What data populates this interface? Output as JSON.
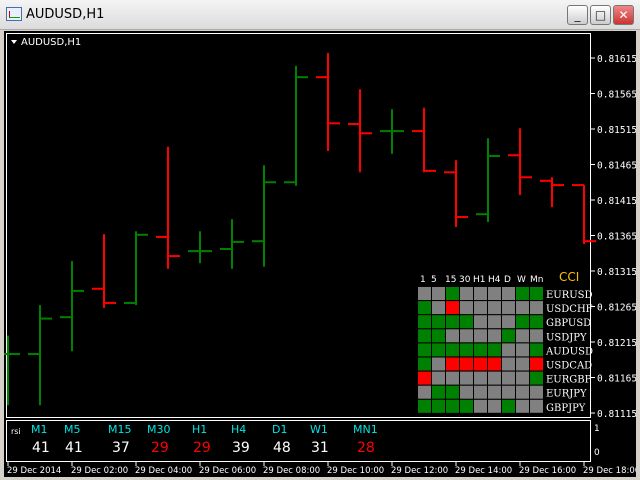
{
  "window": {
    "title": "AUDUSD,H1",
    "minimize": "_",
    "maximize": "□",
    "close": "✕"
  },
  "chart": {
    "label": "AUDUSD,H1",
    "colors": {
      "up": "#008000",
      "down": "#ff0000",
      "bg": "#000000",
      "text": "#ffffff",
      "cci": "#ffc000",
      "cyan": "#00e5e5",
      "gray": "#808080"
    },
    "price_range": [
      0.81115,
      0.81615
    ],
    "price_labels": [
      "0.81615",
      "0.81565",
      "0.81515",
      "0.81465",
      "0.81415",
      "0.81365",
      "0.81315",
      "0.81265",
      "0.81215",
      "0.81165",
      "0.81115"
    ],
    "bars": [
      {
        "o": 0.81198,
        "h": 0.81224,
        "l": 0.81126,
        "c": 0.81198
      },
      {
        "o": 0.81198,
        "h": 0.81267,
        "l": 0.81126,
        "c": 0.81248
      },
      {
        "o": 0.8125,
        "h": 0.81329,
        "l": 0.81202,
        "c": 0.81287
      },
      {
        "o": 0.8129,
        "h": 0.81367,
        "l": 0.81263,
        "c": 0.8127
      },
      {
        "o": 0.8127,
        "h": 0.81371,
        "l": 0.81267,
        "c": 0.81366
      },
      {
        "o": 0.81363,
        "h": 0.8149,
        "l": 0.81318,
        "c": 0.81336
      },
      {
        "o": 0.81343,
        "h": 0.81371,
        "l": 0.81326,
        "c": 0.81343
      },
      {
        "o": 0.81346,
        "h": 0.81388,
        "l": 0.81318,
        "c": 0.81356
      },
      {
        "o": 0.81357,
        "h": 0.81464,
        "l": 0.81321,
        "c": 0.8144
      },
      {
        "o": 0.8144,
        "h": 0.81604,
        "l": 0.81435,
        "c": 0.81588
      },
      {
        "o": 0.81588,
        "h": 0.81622,
        "l": 0.81484,
        "c": 0.81523
      },
      {
        "o": 0.81522,
        "h": 0.81571,
        "l": 0.81454,
        "c": 0.81509
      },
      {
        "o": 0.81512,
        "h": 0.81543,
        "l": 0.8148,
        "c": 0.81512
      },
      {
        "o": 0.81512,
        "h": 0.81545,
        "l": 0.81454,
        "c": 0.81456
      },
      {
        "o": 0.81454,
        "h": 0.81471,
        "l": 0.81377,
        "c": 0.81391
      },
      {
        "o": 0.81395,
        "h": 0.81502,
        "l": 0.81384,
        "c": 0.81477
      },
      {
        "o": 0.81478,
        "h": 0.81516,
        "l": 0.81422,
        "c": 0.81447
      },
      {
        "o": 0.81442,
        "h": 0.81447,
        "l": 0.81405,
        "c": 0.81436
      },
      {
        "o": 0.81436,
        "h": 0.81436,
        "l": 0.81353,
        "c": 0.81357
      }
    ],
    "time_labels": [
      "29 Dec 2014",
      "29 Dec 02:00",
      "29 Dec 04:00",
      "29 Dec 06:00",
      "29 Dec 08:00",
      "29 Dec 10:00",
      "29 Dec 12:00",
      "29 Dec 14:00",
      "29 Dec 16:00",
      "29 Dec 18:00"
    ]
  },
  "cci": {
    "title": "CCI",
    "timeframes": [
      "1",
      "5",
      "15",
      "30",
      "H1",
      "H4",
      "D",
      "W",
      "Mn"
    ],
    "legend": {
      "G": "#008000",
      "g": "#808080",
      "R": "#ff0000"
    },
    "rows": [
      {
        "symbol": "EURUSD",
        "cells": "ggGggggGG"
      },
      {
        "symbol": "USDCHF",
        "cells": "GgRgggggg"
      },
      {
        "symbol": "GBPUSD",
        "cells": "GGGGgggGG"
      },
      {
        "symbol": "USDJPY",
        "cells": "GGggggGgg"
      },
      {
        "symbol": "AUDUSD",
        "cells": "GGGGGGggG"
      },
      {
        "symbol": "USDCAD",
        "cells": "GgRRRRggR"
      },
      {
        "symbol": "EURGBP",
        "cells": "RgggggggG"
      },
      {
        "symbol": "EURJPY",
        "cells": "gGGggggggG"
      },
      {
        "symbol": "GBPJPY",
        "cells": "GGGGggGgg"
      }
    ]
  },
  "rsi": {
    "label": "rsi",
    "scale": [
      "1",
      "0"
    ],
    "items": [
      {
        "tf": "M1",
        "value": "41",
        "low": false
      },
      {
        "tf": "M5",
        "value": "41",
        "low": false
      },
      {
        "tf": "M15",
        "value": "37",
        "low": false
      },
      {
        "tf": "M30",
        "value": "29",
        "low": true
      },
      {
        "tf": "H1",
        "value": "29",
        "low": true
      },
      {
        "tf": "H4",
        "value": "39",
        "low": false
      },
      {
        "tf": "D1",
        "value": "48",
        "low": false
      },
      {
        "tf": "W1",
        "value": "31",
        "low": false
      },
      {
        "tf": "MN1",
        "value": "28",
        "low": true
      }
    ]
  }
}
